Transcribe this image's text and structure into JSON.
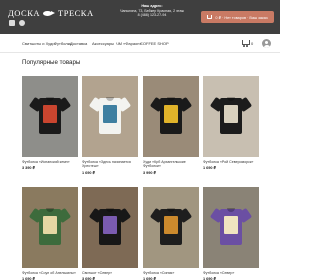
{
  "header": {
    "logo_left": "ДОСКА",
    "logo_right": "ТРЕСКА",
    "address_label": "Наш адрес:",
    "address_line1": "Чапыгина, 73, Бейкер Красная, 2 этаж",
    "address_line2": "8 (488) 123-27-94",
    "cart_button": "0 ₽ · Нет товаров · Ваш заказ"
  },
  "nav": {
    "items": [
      "Свитшоты и Худи",
      "Футболки",
      "Доставка",
      "Аксессуары",
      "ЧМ «Фараон»",
      "COFFEE SHOP"
    ],
    "cart_count": "0"
  },
  "section": {
    "title": "Популярные товары"
  },
  "products": [
    {
      "name": "Футболка «Испанский кемп»",
      "price": "3 390 ₽",
      "shirt_color": "#1a1a1a",
      "print_color": "#c9452f",
      "bg": "#8e8e8a"
    },
    {
      "name": "Футболка «Здесь начинается Хрестеш»",
      "price": "1 690 ₽",
      "shirt_color": "#f3f3f0",
      "print_color": "#3f7fa0",
      "bg": "#b2a38f"
    },
    {
      "name": "Худи «Крб Архангельские Футболки»",
      "price": "3 990 ₽",
      "shirt_color": "#1a1a1a",
      "print_color": "#e0b32a",
      "bg": "#9a8b78"
    },
    {
      "name": "Футболка «Рой Североморск»",
      "price": "1 690 ₽",
      "shirt_color": "#1c1c1c",
      "print_color": "#d8d0bd",
      "bg": "#c8bfb1"
    },
    {
      "name": "Футболка «Соул об Апельсины»",
      "price": "1 690 ₽",
      "shirt_color": "#3d6b3c",
      "print_color": "#e6d7a3",
      "bg": "#8a7a5f"
    },
    {
      "name": "Свитшот «Север»",
      "price": "3 690 ₽",
      "shirt_color": "#171717",
      "print_color": "#7a5bb0",
      "bg": "#7e6a55"
    },
    {
      "name": "Футболка «Синяя»",
      "price": "1 690 ₽",
      "shirt_color": "#1e1e1e",
      "print_color": "#cc8a2d",
      "bg": "#a19680"
    },
    {
      "name": "Футболка «Север»",
      "price": "1 690 ₽",
      "shirt_color": "#6b4fa3",
      "print_color": "#f0e4c0",
      "bg": "#8a8376"
    }
  ]
}
